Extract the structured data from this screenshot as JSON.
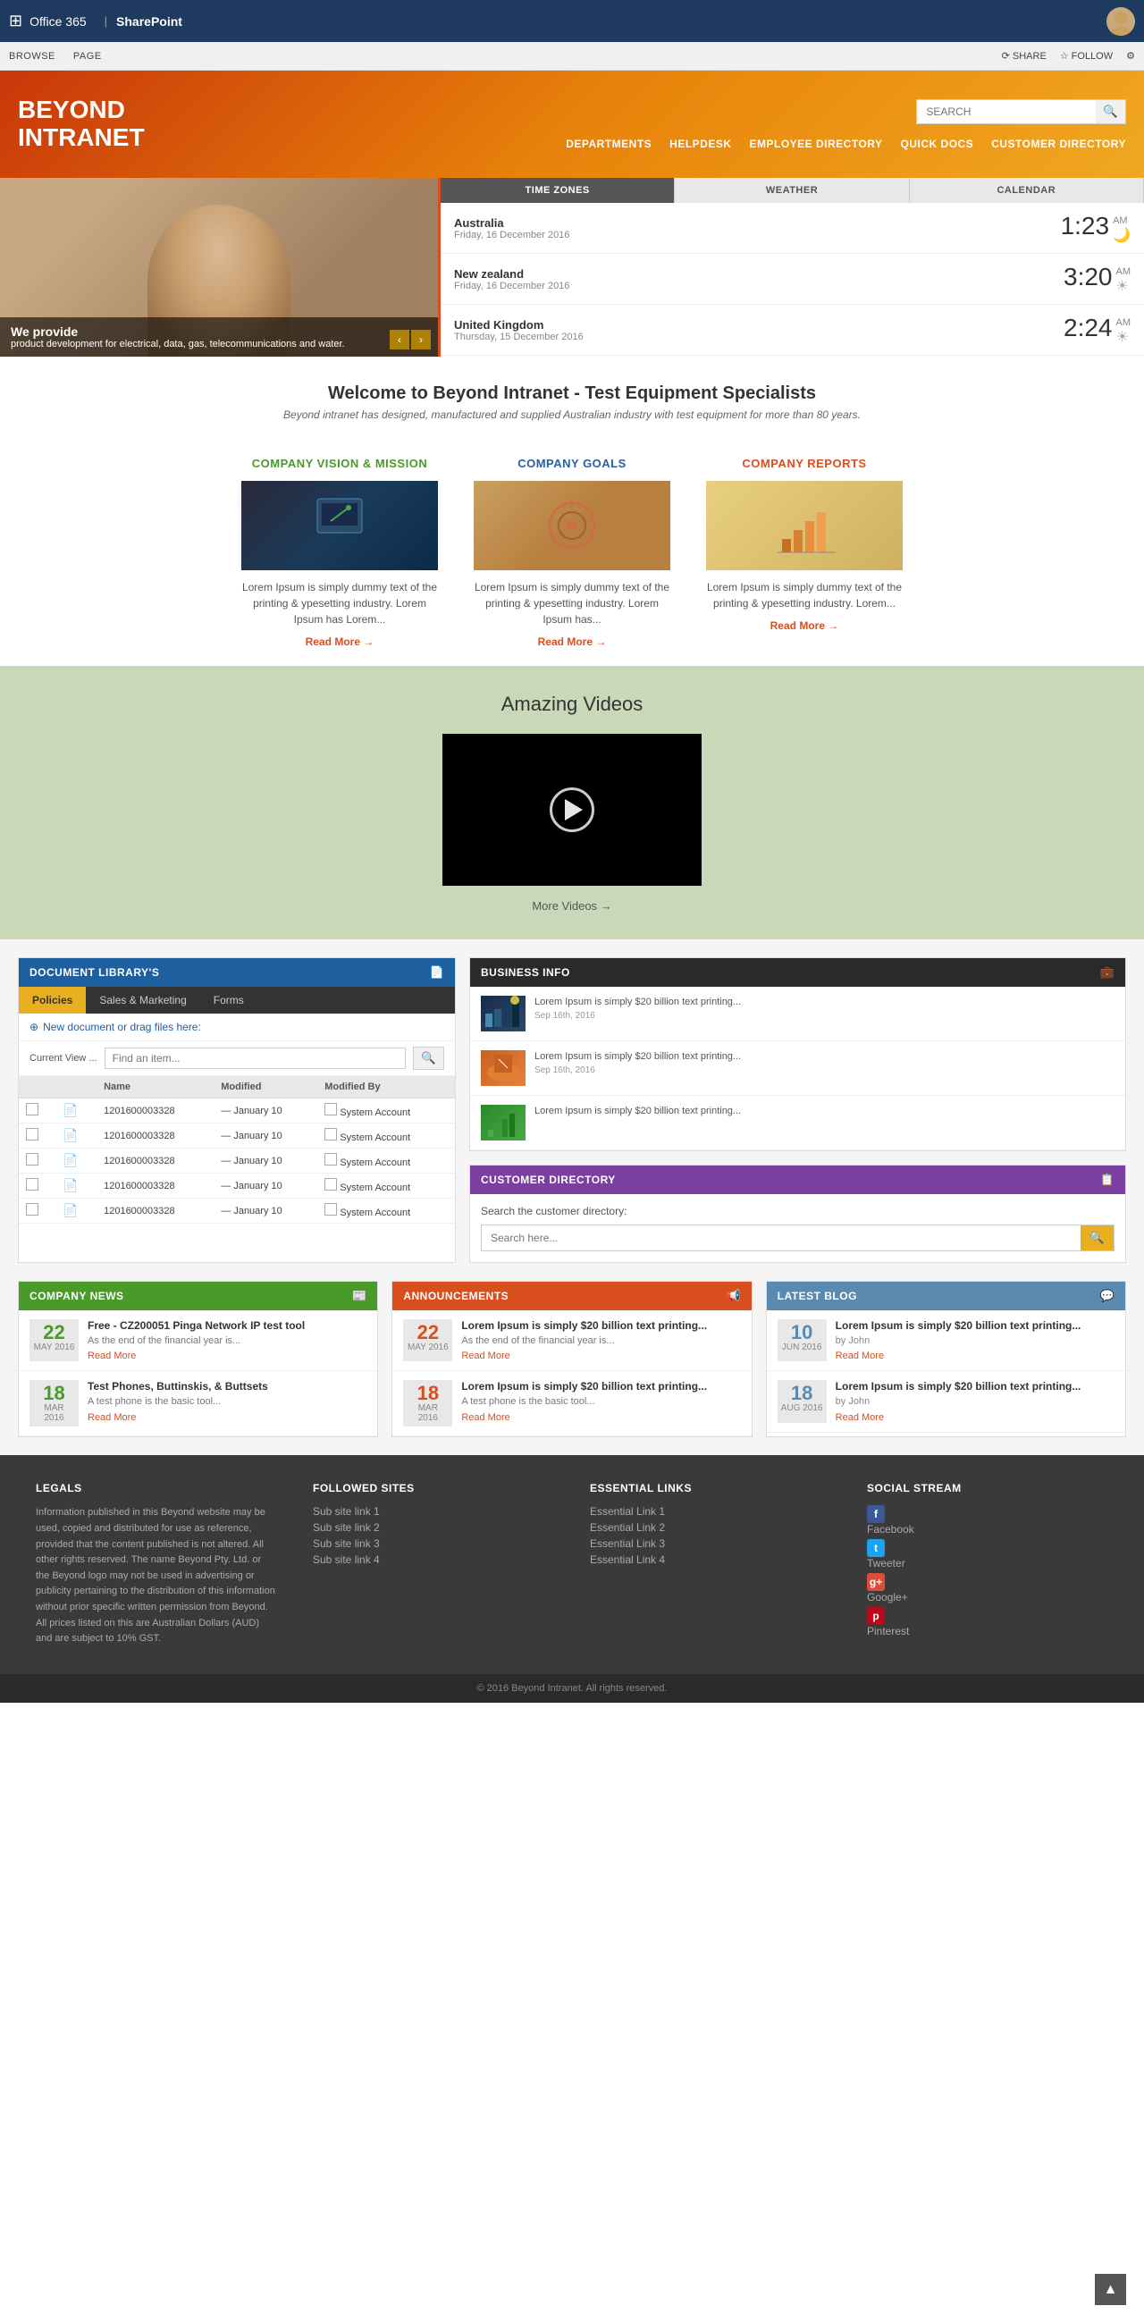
{
  "topbar": {
    "office365": "Office 365",
    "sharepoint": "SharePoint"
  },
  "ribbon": {
    "browse": "BROWSE",
    "page": "PAGE",
    "share": "SHARE",
    "follow": "FOLLOW"
  },
  "header": {
    "logo_line1": "BEYOND",
    "logo_line2": "INTRANET",
    "search_placeholder": "SEARCH",
    "nav": [
      {
        "label": "DEPARTMENTS"
      },
      {
        "label": "HELPDESK"
      },
      {
        "label": "EMPLOYEE DIRECTORY"
      },
      {
        "label": "QUICK DOCS"
      },
      {
        "label": "CUSTOMER DIRECTORY"
      }
    ]
  },
  "hero": {
    "caption_title": "We provide",
    "caption_text": "product development for electrical, data, gas, telecommunications and water."
  },
  "timezones": {
    "tabs": [
      "TIME ZONES",
      "WEATHER",
      "CALENDAR"
    ],
    "active_tab": "TIME ZONES",
    "items": [
      {
        "name": "Australia",
        "date": "Friday, 16 December 2016",
        "time": "1:23",
        "ampm": "AM",
        "icon": "🌙"
      },
      {
        "name": "New zealand",
        "date": "Friday, 16 December 2016",
        "time": "3:20",
        "ampm": "AM",
        "icon": "☀"
      },
      {
        "name": "United Kingdom",
        "date": "Thursday, 15 December 2016",
        "time": "2:24",
        "ampm": "AM",
        "icon": "☀"
      }
    ]
  },
  "welcome": {
    "title": "Welcome to Beyond Intranet - Test Equipment Specialists",
    "subtitle": "Beyond intranet has designed, manufactured and supplied Australian industry with test equipment for more than 80 years."
  },
  "company_cards": [
    {
      "title": "COMPANY VISION & MISSION",
      "color": "green",
      "text": "Lorem Ipsum is simply dummy text of the printing & ypesetting industry. Lorem Ipsum has Lorem...",
      "read_more": "Read More"
    },
    {
      "title": "COMPANY GOALS",
      "color": "blue",
      "text": "Lorem Ipsum is simply dummy text of the printing & ypesetting industry. Lorem Ipsum has...",
      "read_more": "Read More"
    },
    {
      "title": "COMPANY REPORTS",
      "color": "orange",
      "text": "Lorem Ipsum is simply dummy text of the printing & ypesetting industry. Lorem...",
      "read_more": "Read More"
    }
  ],
  "videos": {
    "title": "Amazing Videos",
    "more_videos": "More Videos"
  },
  "doc_library": {
    "header": "DOCUMENT LIBRARY'S",
    "tabs": [
      "Policies",
      "Sales & Marketing",
      "Forms"
    ],
    "active_tab": "Policies",
    "new_doc_label": "New document or drag files here:",
    "search_label": "Current View ...",
    "search_placeholder": "Find an item...",
    "columns": [
      "",
      "",
      "Name",
      "Modified",
      "Modified By"
    ],
    "rows": [
      {
        "name": "1201600003328",
        "modified": "— January 10",
        "modified_by": "System Account"
      },
      {
        "name": "1201600003328",
        "modified": "— January 10",
        "modified_by": "System Account"
      },
      {
        "name": "1201600003328",
        "modified": "— January 10",
        "modified_by": "System Account"
      },
      {
        "name": "1201600003328",
        "modified": "— January 10",
        "modified_by": "System Account"
      },
      {
        "name": "1201600003328",
        "modified": "— January 10",
        "modified_by": "System Account"
      }
    ]
  },
  "business_info": {
    "header": "BUSINESS INFO",
    "items": [
      {
        "text": "Lorem Ipsum is simply $20 billion text printing...",
        "date": "Sep 16th, 2016"
      },
      {
        "text": "Lorem Ipsum is simply $20 billion text printing...",
        "date": "Sep 16th, 2016"
      },
      {
        "text": "Lorem Ipsum is simply $20 billion text printing...",
        "date": ""
      }
    ]
  },
  "customer_directory": {
    "header": "CUSTOMER DIRECTORY",
    "label": "Search the customer directory:",
    "search_placeholder": "Search here..."
  },
  "company_news": {
    "header": "COMPANY NEWS",
    "items": [
      {
        "day": "22",
        "month": "MAY 2016",
        "title": "Free - CZ200051 Pinga Network IP test tool",
        "excerpt": "As the end of the financial year is...",
        "read_more": "Read More"
      },
      {
        "day": "18",
        "month": "MAR 2016",
        "title": "Test Phones, Buttinskis, & Buttsets",
        "excerpt": "A test phone is the basic tool...",
        "read_more": "Read More"
      }
    ]
  },
  "announcements": {
    "header": "ANNOUNCEMENTS",
    "items": [
      {
        "day": "22",
        "month": "MAY 2016",
        "title": "Lorem Ipsum is simply $20 billion text printing...",
        "excerpt": "As the end of the financial year is...",
        "read_more": "Read More"
      },
      {
        "day": "18",
        "month": "MAR 2016",
        "title": "Lorem Ipsum is simply $20 billion text printing...",
        "excerpt": "A test phone is the basic tool...",
        "read_more": "Read More"
      }
    ]
  },
  "latest_blog": {
    "header": "LATEST BLOG",
    "items": [
      {
        "day": "10",
        "month": "JUN 2016",
        "title": "Lorem Ipsum is simply $20 billion text printing...",
        "by": "by John",
        "excerpt": "",
        "read_more": "Read More"
      },
      {
        "day": "18",
        "month": "AUG 2016",
        "title": "Lorem Ipsum is simply $20 billion text printing...",
        "by": "by John",
        "excerpt": "",
        "read_more": "Read More"
      }
    ]
  },
  "footer": {
    "legals_title": "LEGALS",
    "legals_text": "Information published in this Beyond website may be used, copied and distributed for use as reference, provided that the content published is not altered. All other rights reserved. The name Beyond Pty. Ltd. or the Beyond logo may not be used in advertising or publicity pertaining to the distribution of this information without prior specific written permission from Beyond. All prices listed on this are Australian Dollars (AUD) and are subject to 10% GST.",
    "followed_title": "FOLLOWED SITES",
    "followed_links": [
      "Sub site link 1",
      "Sub site link 2",
      "Sub site link 3",
      "Sub site link 4"
    ],
    "essential_title": "ESSENTIAL LINKS",
    "essential_links": [
      "Essential Link 1",
      "Essential Link 2",
      "Essential Link 3",
      "Essential Link 4"
    ],
    "social_title": "SOCIAL STREAM",
    "social_links": [
      {
        "label": "Facebook",
        "icon": "f",
        "class": "fb"
      },
      {
        "label": "Tweeter",
        "icon": "t",
        "class": "tw"
      },
      {
        "label": "Google+",
        "icon": "g+",
        "class": "gp"
      },
      {
        "label": "Pinterest",
        "icon": "p",
        "class": "pi"
      }
    ],
    "copyright": "© 2016 Beyond Intranet. All rights reserved."
  }
}
